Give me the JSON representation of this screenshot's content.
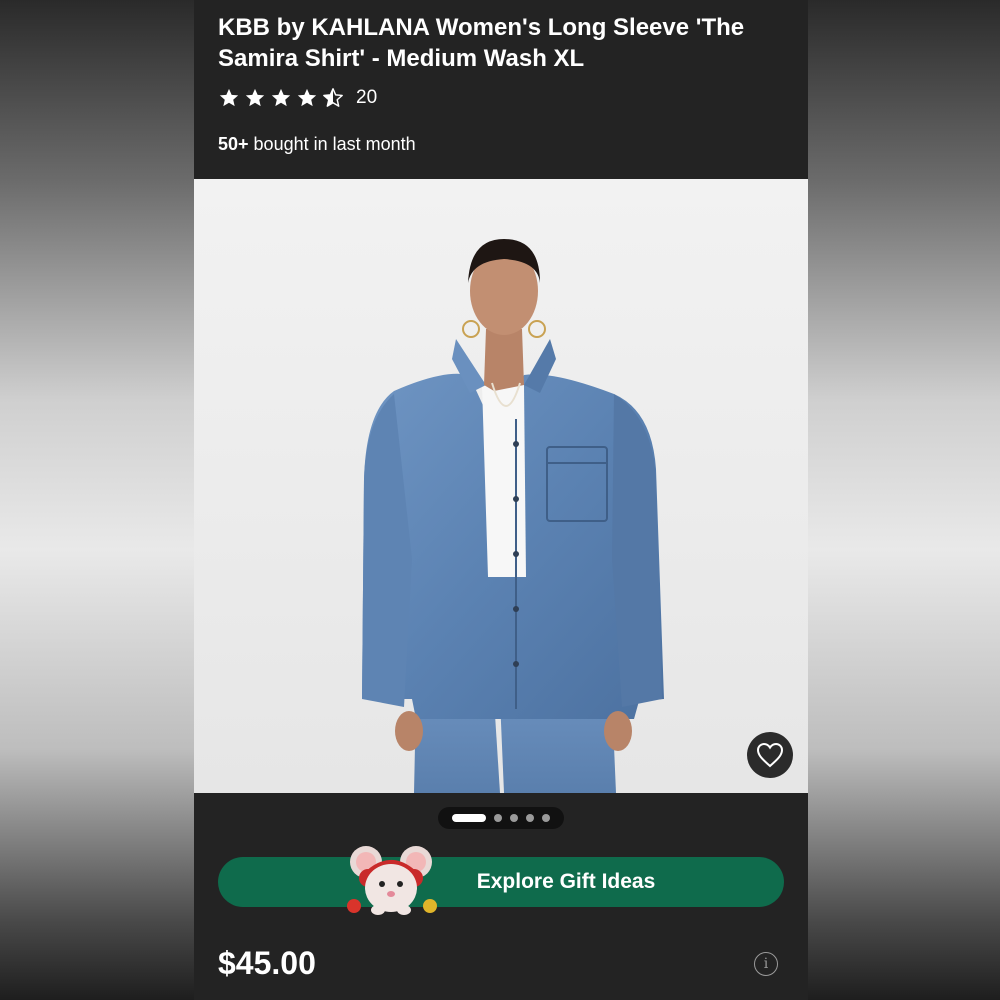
{
  "product": {
    "title": "KBB by KAHLANA Women's Long Sleeve 'The Samira Shirt' - Medium Wash XL",
    "rating": 4.5,
    "rating_count": "20",
    "bought_count": "50+",
    "bought_suffix": " bought in last month",
    "price": "$45.00"
  },
  "gallery": {
    "image_count": 5,
    "active_index": 0,
    "favorite_icon": "heart-icon"
  },
  "promo": {
    "button_label": "Explore Gift Ideas",
    "mascot_icon": "mouse-mascot-icon"
  },
  "icons": {
    "star": "star-icon",
    "info": "info-icon",
    "info_glyph": "i"
  },
  "colors": {
    "background": "#232323",
    "gift_button": "#0f6b4c",
    "text": "#ffffff",
    "denim": "#5f86b6"
  }
}
